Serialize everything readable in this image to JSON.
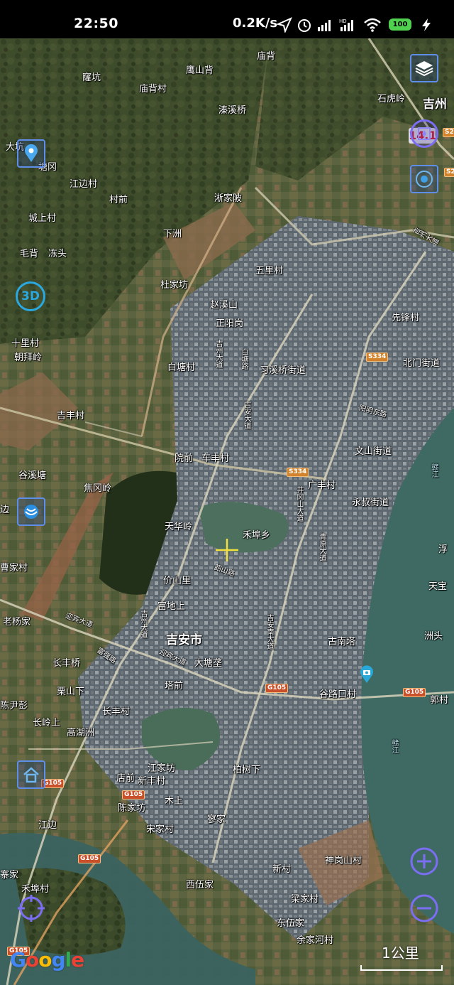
{
  "status_bar": {
    "time": "22:50",
    "network_speed": "0.2K/s",
    "battery": "100",
    "icons": [
      "location-arrow-icon",
      "alarm-icon",
      "signal-icon",
      "hd-signal-icon",
      "wifi-icon",
      "battery-icon",
      "charging-icon"
    ]
  },
  "map": {
    "zoom_level": "14.1",
    "scale_label": "1公里",
    "attribution": "Google",
    "place_labels": [
      {
        "text": "庙背",
        "style": ""
      },
      {
        "text": "窿坑",
        "style": ""
      },
      {
        "text": "鹰山背",
        "style": ""
      },
      {
        "text": "庙背村",
        "style": ""
      },
      {
        "text": "溱溪桥",
        "style": ""
      },
      {
        "text": "石虎岭",
        "style": ""
      },
      {
        "text": "吉州",
        "style": "big"
      },
      {
        "text": "大坑",
        "style": ""
      },
      {
        "text": "塘冈",
        "style": ""
      },
      {
        "text": "江边村",
        "style": ""
      },
      {
        "text": "村前",
        "style": ""
      },
      {
        "text": "淅家陂",
        "style": ""
      },
      {
        "text": "城上村",
        "style": ""
      },
      {
        "text": "下洲",
        "style": ""
      },
      {
        "text": "毛背",
        "style": ""
      },
      {
        "text": "冻头",
        "style": ""
      },
      {
        "text": "五里村",
        "style": ""
      },
      {
        "text": "杜家坊",
        "style": ""
      },
      {
        "text": "赵溪山",
        "style": ""
      },
      {
        "text": "正阳岗",
        "style": ""
      },
      {
        "text": "先锋村",
        "style": ""
      },
      {
        "text": "十里村",
        "style": ""
      },
      {
        "text": "朝拜岭",
        "style": ""
      },
      {
        "text": "白塘村",
        "style": ""
      },
      {
        "text": "习溪桥街道",
        "style": ""
      },
      {
        "text": "北门街道",
        "style": ""
      },
      {
        "text": "吉丰村",
        "style": ""
      },
      {
        "text": "文山街道",
        "style": ""
      },
      {
        "text": "谷溪塘",
        "style": ""
      },
      {
        "text": "院前",
        "style": ""
      },
      {
        "text": "车丰村",
        "style": ""
      },
      {
        "text": "焦冈岭",
        "style": ""
      },
      {
        "text": "广丰村",
        "style": ""
      },
      {
        "text": "永叔街道",
        "style": ""
      },
      {
        "text": "天华岭",
        "style": ""
      },
      {
        "text": "禾埠乡",
        "style": ""
      },
      {
        "text": "曹家村",
        "style": ""
      },
      {
        "text": "价山里",
        "style": ""
      },
      {
        "text": "天宝",
        "style": ""
      },
      {
        "text": "浮",
        "style": ""
      },
      {
        "text": "富地上",
        "style": ""
      },
      {
        "text": "老杨家",
        "style": ""
      },
      {
        "text": "吉安市",
        "style": "big"
      },
      {
        "text": "古南塔",
        "style": ""
      },
      {
        "text": "洲头",
        "style": ""
      },
      {
        "text": "长丰桥",
        "style": ""
      },
      {
        "text": "大塘垄",
        "style": ""
      },
      {
        "text": "塔前",
        "style": ""
      },
      {
        "text": "栗山下",
        "style": ""
      },
      {
        "text": "谷路口村",
        "style": ""
      },
      {
        "text": "郭村",
        "style": ""
      },
      {
        "text": "陈尹彭",
        "style": ""
      },
      {
        "text": "长丰村",
        "style": ""
      },
      {
        "text": "长岭上",
        "style": ""
      },
      {
        "text": "高湖洲",
        "style": ""
      },
      {
        "text": "江家坊",
        "style": ""
      },
      {
        "text": "柏树下",
        "style": ""
      },
      {
        "text": "店前",
        "style": ""
      },
      {
        "text": "新丰村",
        "style": ""
      },
      {
        "text": "木上",
        "style": ""
      },
      {
        "text": "陈家坊",
        "style": ""
      },
      {
        "text": "江边",
        "style": ""
      },
      {
        "text": "寥家",
        "style": ""
      },
      {
        "text": "宋家村",
        "style": ""
      },
      {
        "text": "新村",
        "style": ""
      },
      {
        "text": "神岗山村",
        "style": ""
      },
      {
        "text": "寨家",
        "style": ""
      },
      {
        "text": "禾埠村",
        "style": ""
      },
      {
        "text": "西伍家",
        "style": ""
      },
      {
        "text": "梁家村",
        "style": ""
      },
      {
        "text": "东伍家",
        "style": ""
      },
      {
        "text": "余家河村",
        "style": ""
      },
      {
        "text": "边",
        "style": ""
      }
    ],
    "road_labels": [
      "迎宾大道",
      "吉州大道",
      "白塘路",
      "阳明东路",
      "吉安大道",
      "井冈山大道",
      "迎宾大道",
      "富强路",
      "吉安南大道",
      "韶山路",
      "吉州大道",
      "青原大道",
      "赣江",
      "赣江",
      "吉州大道"
    ],
    "road_badges": [
      "S2",
      "S334",
      "S334",
      "G105",
      "G105",
      "G105",
      "G105",
      "G105",
      "G105",
      "S2"
    ]
  },
  "controls": {
    "layers_icon": "layers-icon",
    "compass_icon": "compass-icon",
    "camera_icon": "camera-icon",
    "location_pin_icon": "location-pin-icon",
    "three_d_label": "3D",
    "satellite_icon": "satellite-icon",
    "home_icon": "home-icon",
    "gps_target_icon": "gps-target-icon",
    "zoom_in_icon": "zoom-in-icon",
    "zoom_out_icon": "zoom-out-icon"
  },
  "colors": {
    "control_blue": "#5e8ee8",
    "control_purple": "#7b6ef2",
    "river": "#3f6a63",
    "zoom_level_text": "#d92030"
  }
}
